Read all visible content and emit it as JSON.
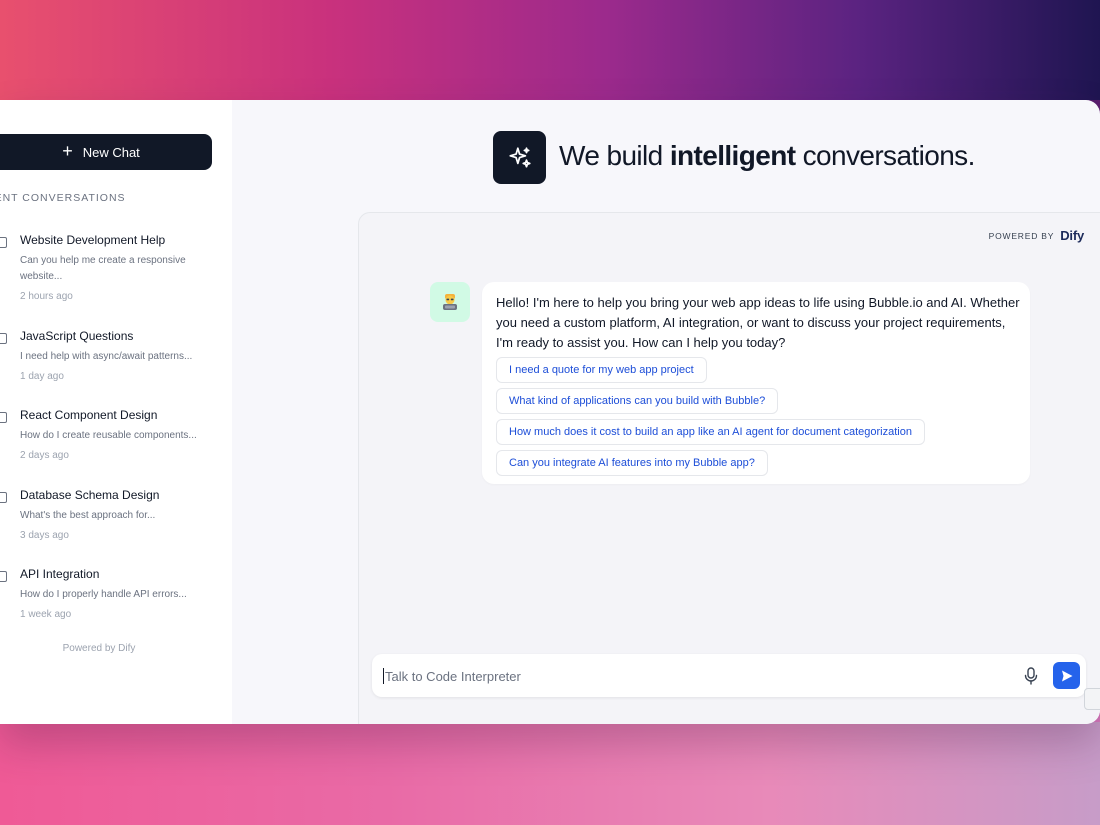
{
  "sidebar": {
    "new_chat_label": "New Chat",
    "recent_heading": "CENT CONVERSATIONS",
    "conversations": [
      {
        "title": "Website Development Help",
        "preview": "Can you help me create a responsive website...",
        "time": "2 hours ago"
      },
      {
        "title": "JavaScript Questions",
        "preview": "I need help with async/await patterns...",
        "time": "1 day ago"
      },
      {
        "title": "React Component Design",
        "preview": "How do I create reusable components...",
        "time": "2 days ago"
      },
      {
        "title": "Database Schema Design",
        "preview": "What's the best approach for...",
        "time": "3 days ago"
      },
      {
        "title": "API Integration",
        "preview": "How do I properly handle API errors...",
        "time": "1 week ago"
      }
    ],
    "powered_by": "Powered by Dify"
  },
  "hero": {
    "title_prefix": "We build ",
    "title_bold": "intelligent",
    "title_suffix": " conversations."
  },
  "powered_badge": {
    "label": "POWERED BY",
    "brand": "Dify"
  },
  "chat": {
    "assistant_avatar": "technologist-emoji",
    "message": "Hello! I'm here to help you bring your web app ideas to life using Bubble.io and AI. Whether you need a custom platform, AI integration, or want to discuss your project requirements, I'm ready to assist you. How can I help you today?",
    "suggestions": [
      "I need a quote for my web app project",
      "What kind of applications can you build with Bubble?",
      "How much does it cost to build an app like an AI agent for document categorization",
      "Can you integrate AI features into my Bubble app?"
    ]
  },
  "input": {
    "placeholder": "Talk to Code Interpreter",
    "value": ""
  },
  "colors": {
    "dark": "#111827",
    "accent_blue": "#2563eb",
    "link_blue": "#1d4ed8",
    "avatar_bg": "#d1fae5"
  }
}
